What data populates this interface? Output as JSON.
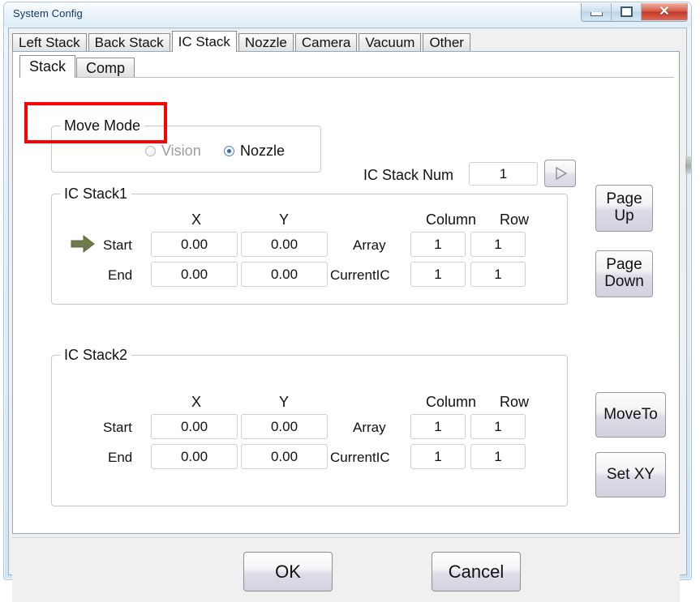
{
  "window": {
    "title": "System Config",
    "controls": {
      "minimize": "minimize",
      "maximize": "maximize",
      "close": "✕"
    }
  },
  "main_tabs": {
    "items": [
      {
        "label": "Left Stack",
        "selected": false
      },
      {
        "label": "Back Stack",
        "selected": false
      },
      {
        "label": "IC Stack",
        "selected": true
      },
      {
        "label": "Nozzle",
        "selected": false
      },
      {
        "label": "Camera",
        "selected": false
      },
      {
        "label": "Vacuum",
        "selected": false
      },
      {
        "label": "Other",
        "selected": false
      }
    ]
  },
  "sub_tabs": {
    "items": [
      {
        "label": "Stack",
        "selected": true
      },
      {
        "label": "Comp",
        "selected": false
      }
    ]
  },
  "move_mode": {
    "legend": "Move Mode",
    "options": [
      {
        "label": "Vision",
        "selected": false,
        "disabled": true
      },
      {
        "label": "Nozzle",
        "selected": true,
        "disabled": false
      }
    ]
  },
  "ic_stack_num": {
    "label": "IC Stack Num",
    "value": "1",
    "next_button_icon": "triangle-right-icon"
  },
  "stacks": [
    {
      "legend": "IC Stack1",
      "has_marker": true,
      "marker_icon": "green-arrow-icon",
      "headers": {
        "x": "X",
        "y": "Y",
        "column": "Column",
        "row": "Row"
      },
      "rows": [
        {
          "label": "Start",
          "x": "0.00",
          "y": "0.00",
          "right_label": "Array",
          "column": "1",
          "row": "1"
        },
        {
          "label": "End",
          "x": "0.00",
          "y": "0.00",
          "right_label": "CurrentIC",
          "column": "1",
          "row": "1"
        }
      ]
    },
    {
      "legend": "IC Stack2",
      "has_marker": false,
      "marker_icon": "",
      "headers": {
        "x": "X",
        "y": "Y",
        "column": "Column",
        "row": "Row"
      },
      "rows": [
        {
          "label": "Start",
          "x": "0.00",
          "y": "0.00",
          "right_label": "Array",
          "column": "1",
          "row": "1"
        },
        {
          "label": "End",
          "x": "0.00",
          "y": "0.00",
          "right_label": "CurrentIC",
          "column": "1",
          "row": "1"
        }
      ]
    }
  ],
  "side_buttons": {
    "page_up": "Page\nUp",
    "page_down": "Page\nDown",
    "move_to": "MoveTo",
    "set_xy": "Set XY"
  },
  "footer": {
    "ok": "OK",
    "cancel": "Cancel"
  },
  "colors": {
    "annotation_red": "#ff0000",
    "accent_blue": "#2b6ea8",
    "marker_green": "#6f7a4a",
    "close_red": "#c0392b"
  }
}
